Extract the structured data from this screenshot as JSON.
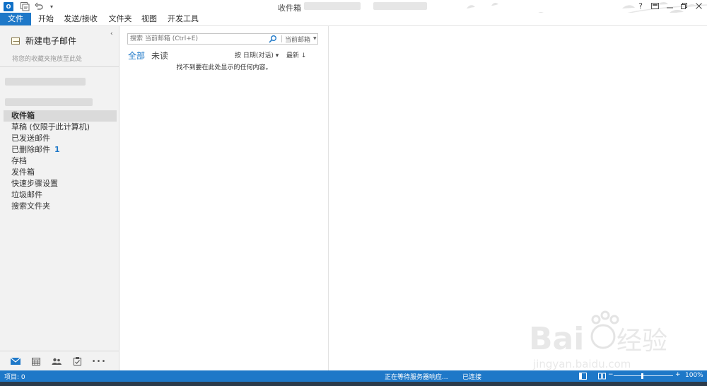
{
  "window": {
    "title": "收件箱 -"
  },
  "ribbon": {
    "tabs": [
      {
        "label": "文件"
      },
      {
        "label": "开始"
      },
      {
        "label": "发送/接收"
      },
      {
        "label": "文件夹"
      },
      {
        "label": "视图"
      },
      {
        "label": "开发工具"
      }
    ]
  },
  "window_controls": {
    "help": "?"
  },
  "nav": {
    "new_mail": "新建电子邮件",
    "favorites_hint": "将您的收藏夹拖放至此处",
    "folders": [
      {
        "label": "收件箱",
        "selected": true
      },
      {
        "label": "草稿 (仅限于此计算机)"
      },
      {
        "label": "已发送邮件"
      },
      {
        "label": "已删除邮件",
        "count": "1"
      },
      {
        "label": "存档"
      },
      {
        "label": "发件箱"
      },
      {
        "label": "快速步骤设置"
      },
      {
        "label": "垃圾邮件"
      },
      {
        "label": "搜索文件夹"
      }
    ],
    "bottom_icons": [
      "mail-icon",
      "calendar-icon",
      "people-icon",
      "tasks-icon",
      "more-icon"
    ],
    "more_label": "•••"
  },
  "list": {
    "search": {
      "placeholder": "搜索 当前邮箱 (Ctrl+E)",
      "scope": "当前邮箱"
    },
    "filters": {
      "all": "全部",
      "unread": "未读"
    },
    "sort": {
      "by": "按 日期(对话) ▾",
      "order": "最新 ↓"
    },
    "empty_message": "找不到要在此处显示的任何内容。"
  },
  "status": {
    "items": "项目: 0",
    "server": "正在等待服务器响应...",
    "connection": "已连接",
    "zoom": "100%"
  },
  "colors": {
    "accent": "#1e78c8",
    "nav_bg": "#f2f2f2",
    "selected": "#dadada"
  }
}
